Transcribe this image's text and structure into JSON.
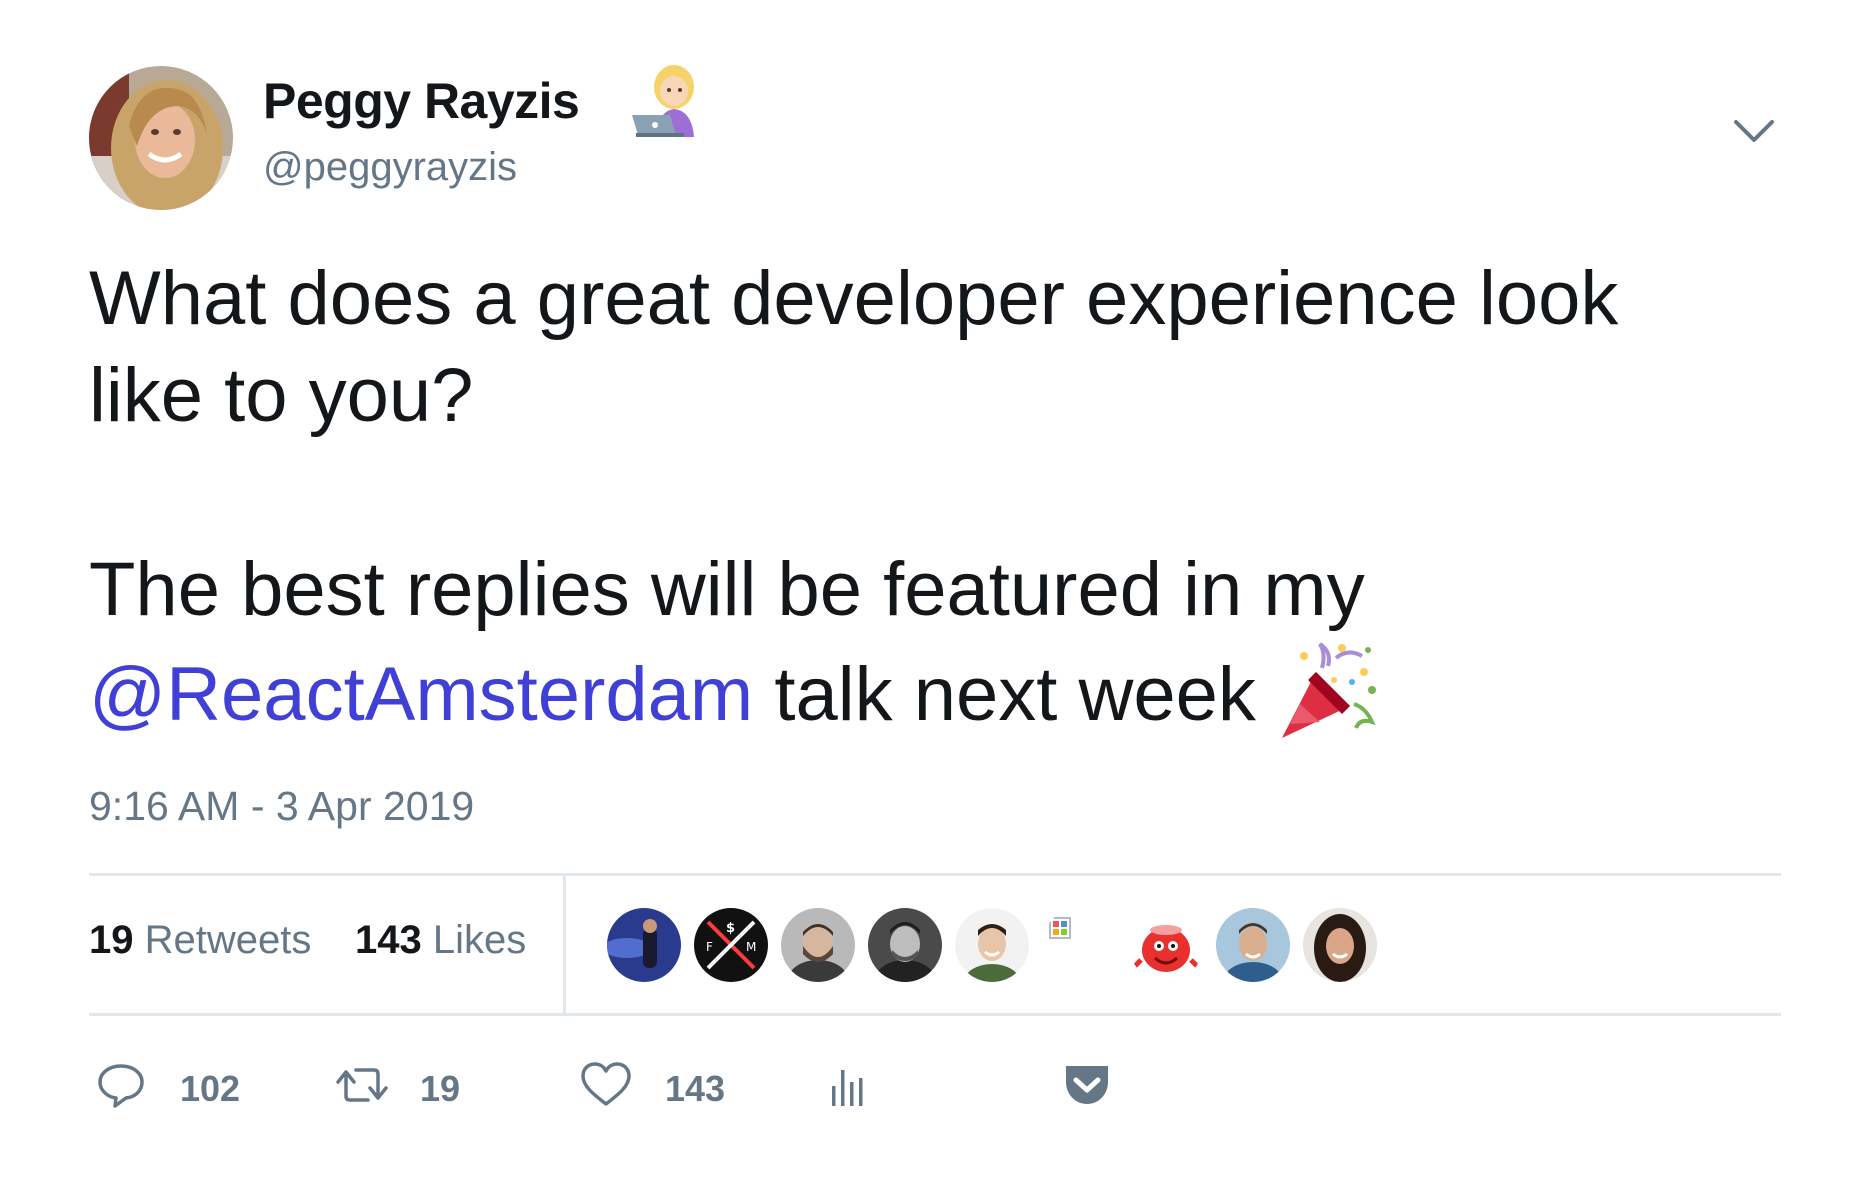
{
  "author": {
    "name": "Peggy Rayzis",
    "name_emoji": "woman-technologist-icon",
    "handle": "@peggyrayzis",
    "avatar_icon": "avatar"
  },
  "tweet": {
    "line1": "What does a great developer experience look",
    "line2": "like to you?",
    "line3": "The best replies will be featured in my",
    "mention": "@ReactAmsterdam",
    "line4_rest": " talk next week",
    "emoji": "party-popper-icon",
    "timestamp": "9:16 AM - 3 Apr 2019"
  },
  "stats": {
    "retweets_count": "19",
    "retweets_label": " Retweets",
    "likes_count": "143",
    "likes_label": " Likes"
  },
  "likers": [
    {
      "icon": "liker-avatar-stage"
    },
    {
      "icon": "liker-avatar-fm-logo"
    },
    {
      "icon": "liker-avatar-man-beard"
    },
    {
      "icon": "liker-avatar-man-bw"
    },
    {
      "icon": "liker-avatar-man-smiling"
    },
    {
      "icon": "liker-avatar-pixel"
    },
    {
      "icon": "liker-avatar-kool-aid"
    },
    {
      "icon": "liker-avatar-man-blue"
    },
    {
      "icon": "liker-avatar-woman"
    }
  ],
  "actions": {
    "reply_count": "102",
    "retweet_count": "19",
    "like_count": "143"
  },
  "colors": {
    "link": "#4040d6",
    "secondary_text": "#657786",
    "divider": "#e1e8ed"
  }
}
